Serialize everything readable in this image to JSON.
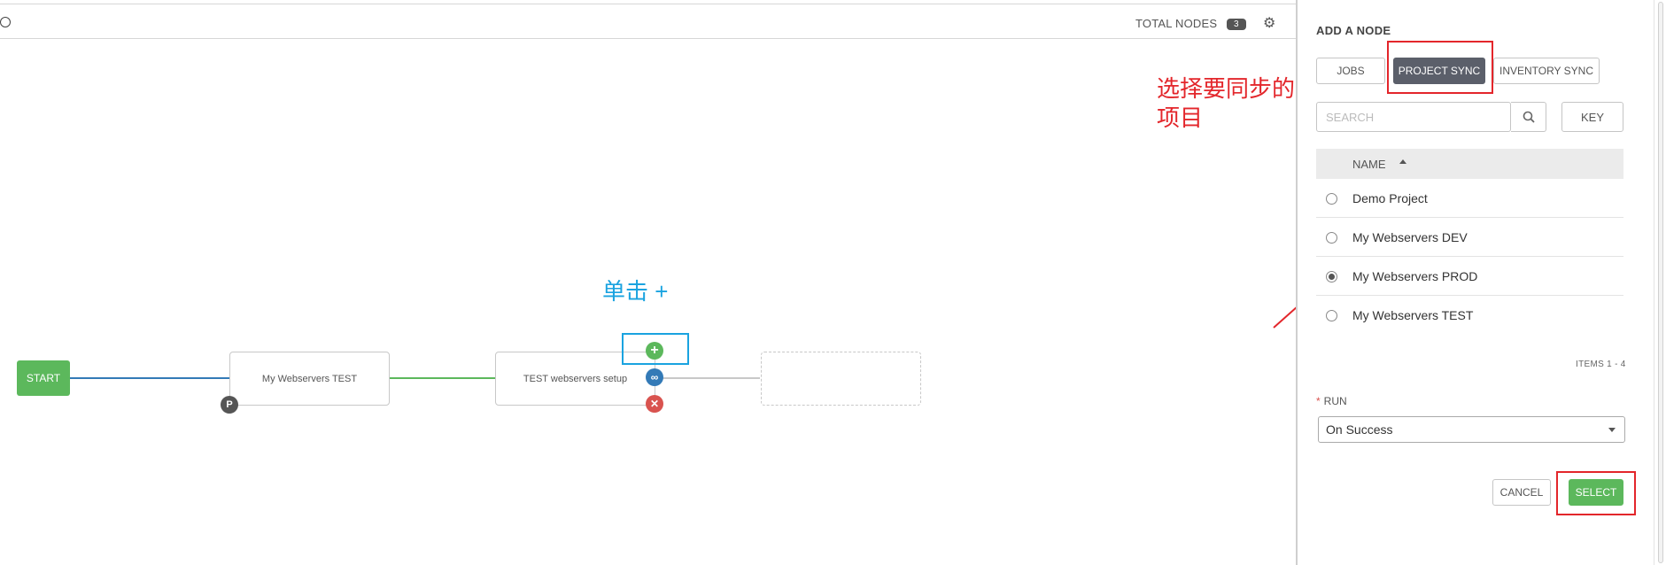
{
  "canvas": {
    "total_nodes_label": "TOTAL NODES",
    "total_nodes_count": "3",
    "start_label": "START",
    "nodes": [
      {
        "label": "My Webservers TEST",
        "badge": "P"
      },
      {
        "label": "TEST webservers setup"
      },
      {
        "label": ""
      }
    ]
  },
  "annotations": {
    "click_plus": "单击 +",
    "choose_project_line1": "选择要同步的",
    "choose_project_line2": "项目"
  },
  "panel": {
    "title": "ADD A NODE",
    "tabs": [
      {
        "label": "JOBS",
        "active": false
      },
      {
        "label": "PROJECT SYNC",
        "active": true
      },
      {
        "label": "INVENTORY SYNC",
        "active": false
      }
    ],
    "search": {
      "placeholder": "SEARCH",
      "value": ""
    },
    "key_label": "KEY",
    "list_header": "NAME",
    "rows": [
      {
        "name": "Demo Project",
        "selected": false
      },
      {
        "name": "My Webservers DEV",
        "selected": false
      },
      {
        "name": "My Webservers PROD",
        "selected": true
      },
      {
        "name": "My Webservers TEST",
        "selected": false
      }
    ],
    "items_count": "ITEMS  1 - 4",
    "run_label": "RUN",
    "run_value": "On Success",
    "cancel_label": "CANCEL",
    "select_label": "SELECT"
  },
  "colors": {
    "success_green": "#5cb85c",
    "link_blue": "#337ab7",
    "failure_red": "#d9534f",
    "annotation_red": "#e3262b",
    "annotation_blue": "#1aa3e0",
    "tab_active": "#5b5f6a"
  }
}
